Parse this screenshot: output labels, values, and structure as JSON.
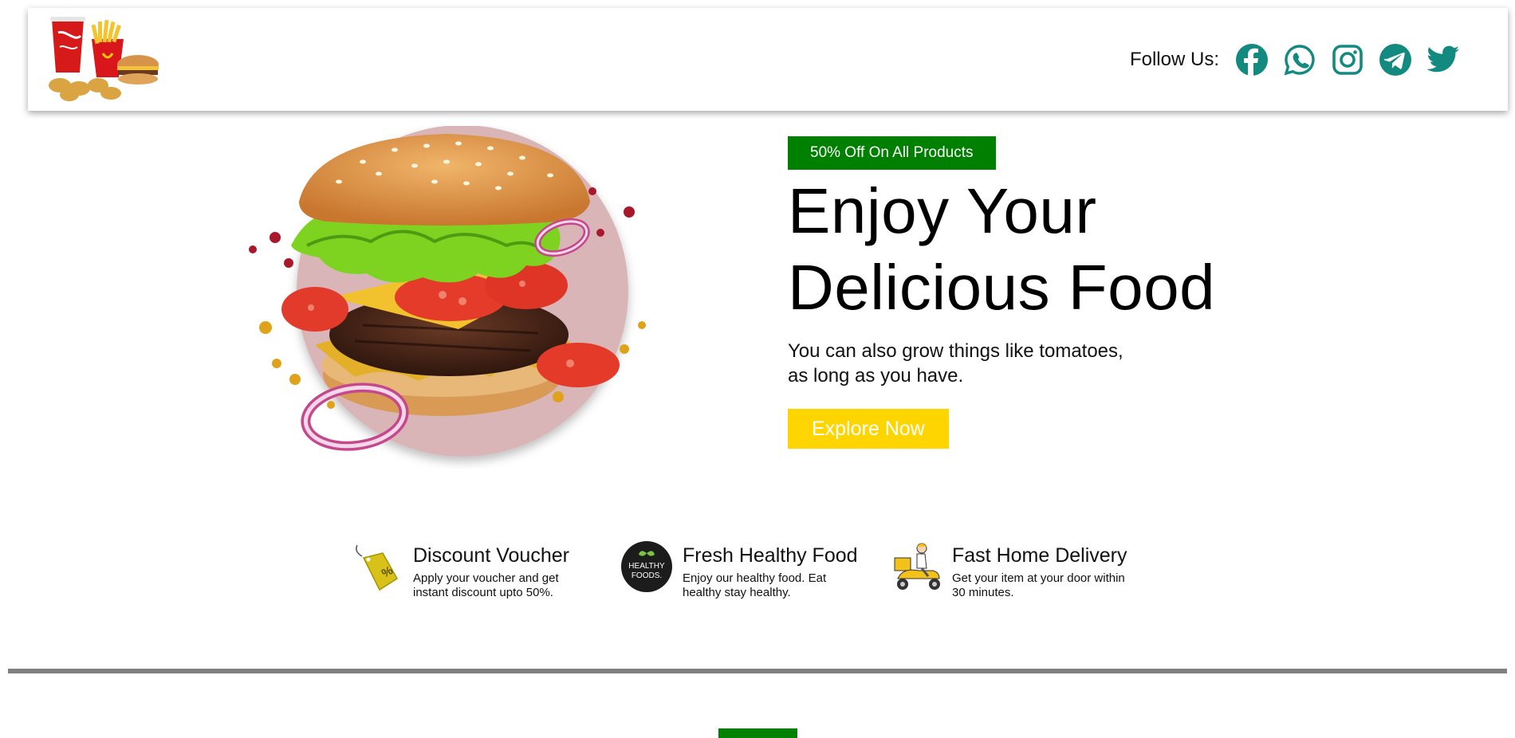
{
  "header": {
    "follow_label": "Follow Us:",
    "social": [
      {
        "name": "facebook-icon"
      },
      {
        "name": "whatsapp-icon"
      },
      {
        "name": "instagram-icon"
      },
      {
        "name": "telegram-icon"
      },
      {
        "name": "twitter-icon"
      }
    ],
    "social_color": "#138a80"
  },
  "hero": {
    "badge": "50% Off On All Products",
    "headline_line1": "Enjoy Your",
    "headline_line2": "Delicious Food",
    "subtext_line1": "You can also grow things like tomatoes,",
    "subtext_line2": "as long as you have.",
    "button": "Explore Now"
  },
  "features": [
    {
      "icon": "discount-tag-icon",
      "title": "Discount Voucher",
      "desc": "Apply your voucher and get instant discount upto 50%."
    },
    {
      "icon": "healthy-foods-icon",
      "title": "Fresh Healthy Food",
      "desc": "Enjoy our healthy food. Eat healthy stay healthy."
    },
    {
      "icon": "delivery-scooter-icon",
      "title": "Fast Home Delivery",
      "desc": "Get your item at your door within 30 minutes."
    }
  ],
  "healthy_logo_text_top": "HEALTHY",
  "healthy_logo_text_bottom": "FOODS.",
  "colors": {
    "badge_green": "#008000",
    "button_yellow": "#ffd500",
    "divider_gray": "#808080"
  }
}
